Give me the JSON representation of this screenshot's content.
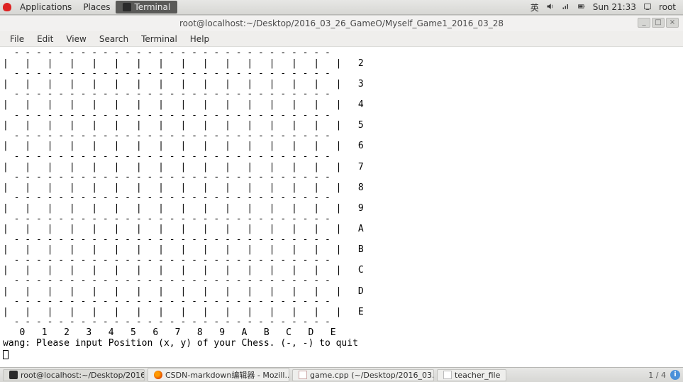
{
  "panel": {
    "applications": "Applications",
    "places": "Places",
    "active_app": "Terminal",
    "ime": "英",
    "clock": "Sun 21:33",
    "user": "root"
  },
  "window": {
    "title": "root@localhost:~/Desktop/2016_03_26_GameO/Myself_Game1_2016_03_28",
    "min": "_",
    "max": "□",
    "close": "×"
  },
  "menubar": {
    "file": "File",
    "edit": "Edit",
    "view": "View",
    "search": "Search",
    "terminal": "Terminal",
    "help": "Help"
  },
  "terminal": {
    "sep": "  - - - - - - - - - - - - - - - - - - - - - - - - - - - - - ",
    "row": "|   |   |   |   |   |   |   |   |   |   |   |   |   |   |   |",
    "labels": [
      "2",
      "3",
      "4",
      "5",
      "6",
      "7",
      "8",
      "9",
      "A",
      "B",
      "C",
      "D",
      "E"
    ],
    "cols": "   0   1   2   3   4   5   6   7   8   9   A   B   C   D   E",
    "prompt": "wang: Please input Position (x, y) of your Chess. (-, -) to quit"
  },
  "taskbar": {
    "items": [
      "root@localhost:~/Desktop/2016...",
      "CSDN-markdown编辑器 - Mozill...",
      "game.cpp (~/Desktop/2016_03....",
      "teacher_file"
    ],
    "workspace": "1 / 4"
  }
}
